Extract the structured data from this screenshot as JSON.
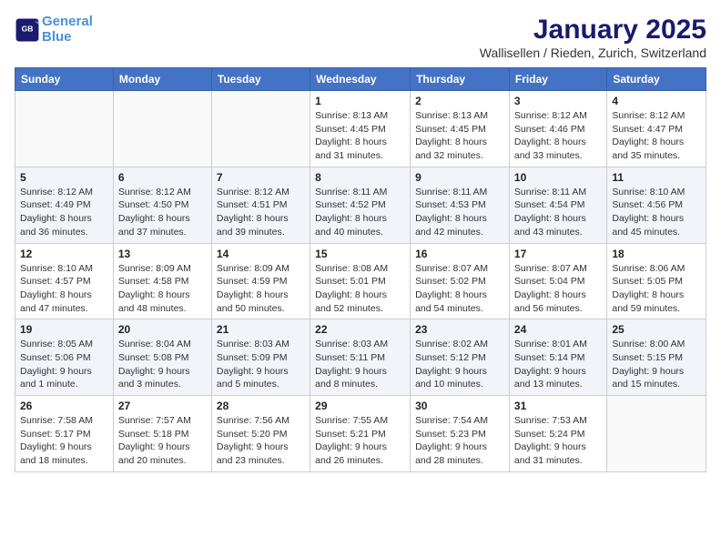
{
  "header": {
    "logo_line1": "General",
    "logo_line2": "Blue",
    "title": "January 2025",
    "subtitle": "Wallisellen / Rieden, Zurich, Switzerland"
  },
  "weekdays": [
    "Sunday",
    "Monday",
    "Tuesday",
    "Wednesday",
    "Thursday",
    "Friday",
    "Saturday"
  ],
  "weeks": [
    [
      {
        "num": "",
        "detail": ""
      },
      {
        "num": "",
        "detail": ""
      },
      {
        "num": "",
        "detail": ""
      },
      {
        "num": "1",
        "detail": "Sunrise: 8:13 AM\nSunset: 4:45 PM\nDaylight: 8 hours\nand 31 minutes."
      },
      {
        "num": "2",
        "detail": "Sunrise: 8:13 AM\nSunset: 4:45 PM\nDaylight: 8 hours\nand 32 minutes."
      },
      {
        "num": "3",
        "detail": "Sunrise: 8:12 AM\nSunset: 4:46 PM\nDaylight: 8 hours\nand 33 minutes."
      },
      {
        "num": "4",
        "detail": "Sunrise: 8:12 AM\nSunset: 4:47 PM\nDaylight: 8 hours\nand 35 minutes."
      }
    ],
    [
      {
        "num": "5",
        "detail": "Sunrise: 8:12 AM\nSunset: 4:49 PM\nDaylight: 8 hours\nand 36 minutes."
      },
      {
        "num": "6",
        "detail": "Sunrise: 8:12 AM\nSunset: 4:50 PM\nDaylight: 8 hours\nand 37 minutes."
      },
      {
        "num": "7",
        "detail": "Sunrise: 8:12 AM\nSunset: 4:51 PM\nDaylight: 8 hours\nand 39 minutes."
      },
      {
        "num": "8",
        "detail": "Sunrise: 8:11 AM\nSunset: 4:52 PM\nDaylight: 8 hours\nand 40 minutes."
      },
      {
        "num": "9",
        "detail": "Sunrise: 8:11 AM\nSunset: 4:53 PM\nDaylight: 8 hours\nand 42 minutes."
      },
      {
        "num": "10",
        "detail": "Sunrise: 8:11 AM\nSunset: 4:54 PM\nDaylight: 8 hours\nand 43 minutes."
      },
      {
        "num": "11",
        "detail": "Sunrise: 8:10 AM\nSunset: 4:56 PM\nDaylight: 8 hours\nand 45 minutes."
      }
    ],
    [
      {
        "num": "12",
        "detail": "Sunrise: 8:10 AM\nSunset: 4:57 PM\nDaylight: 8 hours\nand 47 minutes."
      },
      {
        "num": "13",
        "detail": "Sunrise: 8:09 AM\nSunset: 4:58 PM\nDaylight: 8 hours\nand 48 minutes."
      },
      {
        "num": "14",
        "detail": "Sunrise: 8:09 AM\nSunset: 4:59 PM\nDaylight: 8 hours\nand 50 minutes."
      },
      {
        "num": "15",
        "detail": "Sunrise: 8:08 AM\nSunset: 5:01 PM\nDaylight: 8 hours\nand 52 minutes."
      },
      {
        "num": "16",
        "detail": "Sunrise: 8:07 AM\nSunset: 5:02 PM\nDaylight: 8 hours\nand 54 minutes."
      },
      {
        "num": "17",
        "detail": "Sunrise: 8:07 AM\nSunset: 5:04 PM\nDaylight: 8 hours\nand 56 minutes."
      },
      {
        "num": "18",
        "detail": "Sunrise: 8:06 AM\nSunset: 5:05 PM\nDaylight: 8 hours\nand 59 minutes."
      }
    ],
    [
      {
        "num": "19",
        "detail": "Sunrise: 8:05 AM\nSunset: 5:06 PM\nDaylight: 9 hours\nand 1 minute."
      },
      {
        "num": "20",
        "detail": "Sunrise: 8:04 AM\nSunset: 5:08 PM\nDaylight: 9 hours\nand 3 minutes."
      },
      {
        "num": "21",
        "detail": "Sunrise: 8:03 AM\nSunset: 5:09 PM\nDaylight: 9 hours\nand 5 minutes."
      },
      {
        "num": "22",
        "detail": "Sunrise: 8:03 AM\nSunset: 5:11 PM\nDaylight: 9 hours\nand 8 minutes."
      },
      {
        "num": "23",
        "detail": "Sunrise: 8:02 AM\nSunset: 5:12 PM\nDaylight: 9 hours\nand 10 minutes."
      },
      {
        "num": "24",
        "detail": "Sunrise: 8:01 AM\nSunset: 5:14 PM\nDaylight: 9 hours\nand 13 minutes."
      },
      {
        "num": "25",
        "detail": "Sunrise: 8:00 AM\nSunset: 5:15 PM\nDaylight: 9 hours\nand 15 minutes."
      }
    ],
    [
      {
        "num": "26",
        "detail": "Sunrise: 7:58 AM\nSunset: 5:17 PM\nDaylight: 9 hours\nand 18 minutes."
      },
      {
        "num": "27",
        "detail": "Sunrise: 7:57 AM\nSunset: 5:18 PM\nDaylight: 9 hours\nand 20 minutes."
      },
      {
        "num": "28",
        "detail": "Sunrise: 7:56 AM\nSunset: 5:20 PM\nDaylight: 9 hours\nand 23 minutes."
      },
      {
        "num": "29",
        "detail": "Sunrise: 7:55 AM\nSunset: 5:21 PM\nDaylight: 9 hours\nand 26 minutes."
      },
      {
        "num": "30",
        "detail": "Sunrise: 7:54 AM\nSunset: 5:23 PM\nDaylight: 9 hours\nand 28 minutes."
      },
      {
        "num": "31",
        "detail": "Sunrise: 7:53 AM\nSunset: 5:24 PM\nDaylight: 9 hours\nand 31 minutes."
      },
      {
        "num": "",
        "detail": ""
      }
    ]
  ]
}
